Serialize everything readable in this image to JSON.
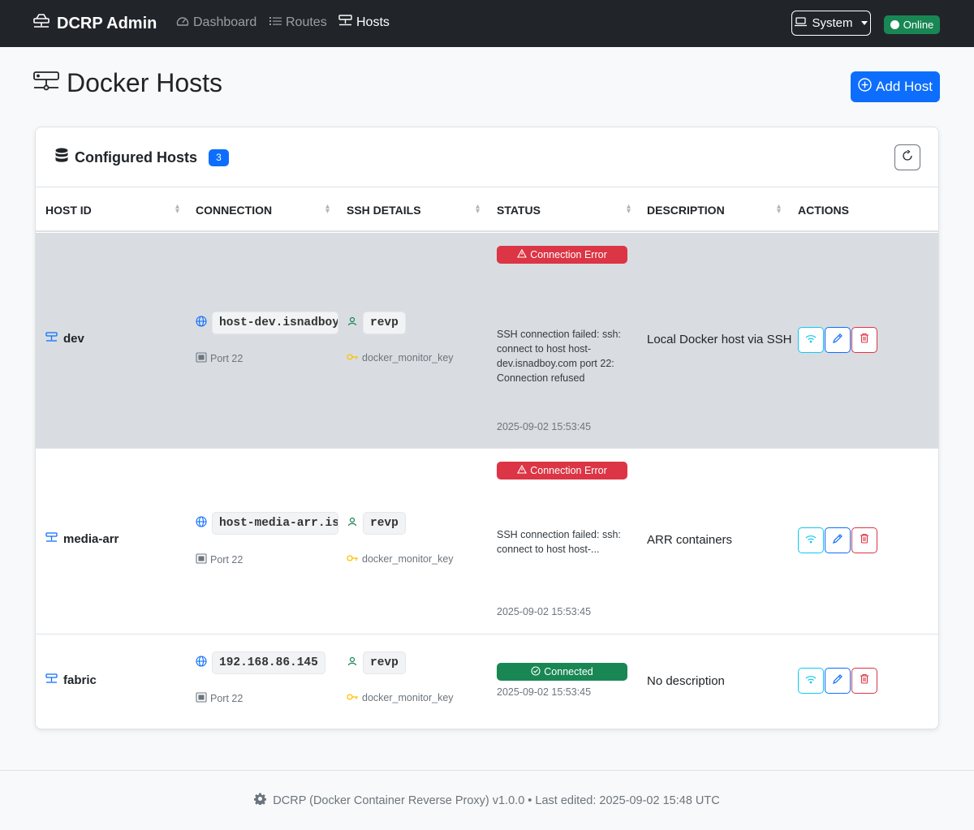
{
  "navbar": {
    "brand": "DCRP Admin",
    "links": [
      {
        "label": "Dashboard",
        "icon": "speedometer-icon"
      },
      {
        "label": "Routes",
        "icon": "list-icon"
      },
      {
        "label": "Hosts",
        "icon": "hdd-network-icon",
        "active": true
      }
    ],
    "theme_label": "System",
    "status_label": "Online"
  },
  "page": {
    "title": "Docker Hosts",
    "add_button": "Add Host"
  },
  "card": {
    "title": "Configured Hosts",
    "count": "3"
  },
  "table": {
    "columns": [
      "HOST ID",
      "CONNECTION",
      "SSH DETAILS",
      "STATUS",
      "DESCRIPTION",
      "ACTIONS"
    ],
    "rows": [
      {
        "host_id": "dev",
        "host": "host-dev.isnadboy.com",
        "port": "Port 22",
        "user": "revp",
        "key": "docker_monitor_key",
        "status": "Connection Error",
        "message": "SSH connection failed: ssh: connect to host host-dev.isnadboy.com port 22: Connection refused",
        "timestamp": "2025-09-02 15:53:45",
        "description": "Local Docker host via SSH"
      },
      {
        "host_id": "media-arr",
        "host": "host-media-arr.isnadboy.com",
        "port": "Port 22",
        "user": "revp",
        "key": "docker_monitor_key",
        "status": "Connection Error",
        "message": "SSH connection failed: ssh: connect to host host-...",
        "timestamp": "2025-09-02 15:53:45",
        "description": "ARR containers"
      },
      {
        "host_id": "fabric",
        "host": "192.168.86.145",
        "port": "Port 22",
        "user": "revp",
        "key": "docker_monitor_key",
        "status": "Connected",
        "message": "",
        "timestamp": "2025-09-02 15:53:45",
        "description": "No description"
      }
    ]
  },
  "footer": {
    "text": "DCRP (Docker Container Reverse Proxy) v1.0.0 • Last edited: 2025-09-02 15:48 UTC"
  },
  "colors": {
    "primary": "#0d6efd",
    "danger": "#dc3545",
    "success": "#198754",
    "info": "#0dcaf0",
    "navbar": "#212529"
  }
}
